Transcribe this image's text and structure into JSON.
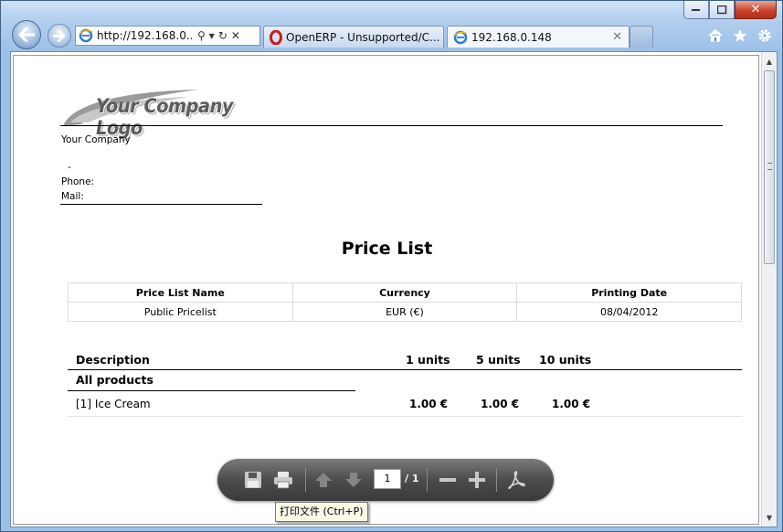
{
  "browser": {
    "address_url": "http://192.168.0....",
    "tabs": [
      {
        "title": "OpenERP - Unsupported/C..."
      },
      {
        "title": "192.168.0.148",
        "close": "✕"
      }
    ],
    "window_controls": {
      "minimize": "—",
      "maximize": "☐",
      "close": "✕"
    },
    "address_controls": {
      "search": "⚲",
      "dropdown": "▾",
      "refresh": "↻",
      "stop": "✕"
    },
    "tools": [
      "home-icon",
      "star-icon",
      "gear-icon"
    ]
  },
  "document": {
    "logo_text": "Your Company Logo",
    "company_name": "Your Company",
    "address_dash": "-",
    "phone_label": "Phone:",
    "mail_label": "Mail:",
    "title": "Price List",
    "info_table": {
      "headers": [
        "Price List Name",
        "Currency",
        "Printing Date"
      ],
      "row": [
        "Public Pricelist",
        "EUR (€)",
        "08/04/2012"
      ]
    },
    "products": {
      "headers": {
        "description": "Description",
        "q1": "1 units",
        "q2": "5 units",
        "q3": "10 units"
      },
      "category": "All products",
      "rows": [
        {
          "name": "[1] Ice Cream",
          "p1": "1.00 €",
          "p2": "1.00 €",
          "p3": "1.00 €"
        }
      ]
    }
  },
  "pdf_toolbar": {
    "page_current": "1",
    "page_total": "/ 1",
    "tooltip": "打印文件 (Ctrl+P)"
  },
  "colors": {
    "close_button": "#c7442c",
    "toolbar": "#4c4c4c",
    "frame": "#9cc0e8"
  }
}
